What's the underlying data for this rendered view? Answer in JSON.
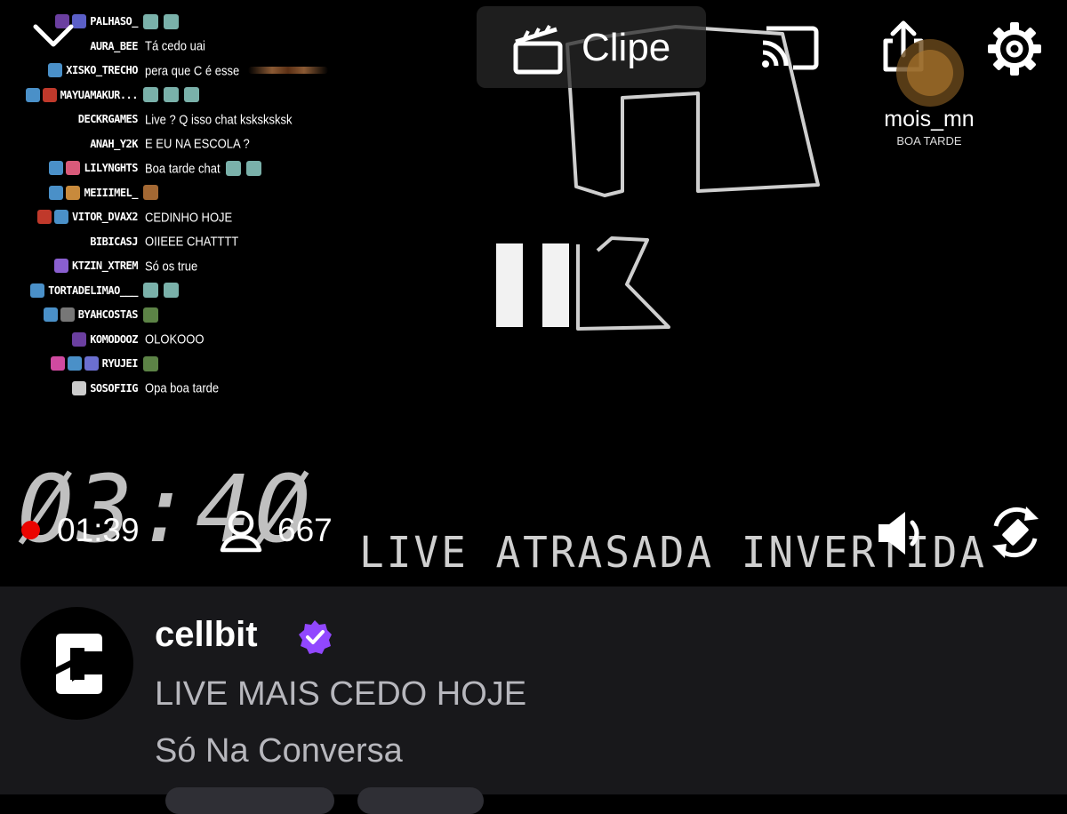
{
  "player": {
    "clip_label": "Clipe",
    "live_time": "01:39",
    "viewer_count": "667",
    "overlay_timer": "Ø3:4Ø",
    "overlay_banner": "LIVE ATRASADA INVERTIDA",
    "overlay_user": {
      "name": "mois_mn",
      "message": "BOA TARDE"
    }
  },
  "chat": [
    {
      "user": "PALHASO_",
      "text": "",
      "badges": [
        "#6b3fa0",
        "#5b5fc7"
      ],
      "emotes": 2
    },
    {
      "user": "AURA_BEE",
      "text": "Tá cedo uai",
      "badges": [],
      "emotes": 0
    },
    {
      "user": "XISKO_TRECHO",
      "text": "pera que C é esse",
      "badges": [
        "#4a90c8"
      ],
      "emotes": 0,
      "strip": true
    },
    {
      "user": "MAYUAMAKUR...",
      "text": "",
      "badges": [
        "#4a90c8",
        "#c0392b"
      ],
      "emotes": 3
    },
    {
      "user": "DECKRGAMES",
      "text": "Live ? Q isso chat ksksksksk",
      "badges": [],
      "emotes": 0
    },
    {
      "user": "ANAH_Y2K",
      "text": "E EU NA ESCOLA ?",
      "badges": [],
      "emotes": 0
    },
    {
      "user": "LILYNGHTS",
      "text": "Boa tarde chat",
      "badges": [
        "#4a90c8",
        "#d85a7a"
      ],
      "emotes": 2
    },
    {
      "user": "MEIIIMEL_",
      "text": "",
      "badges": [
        "#4a90c8",
        "#c88a3c"
      ],
      "emotes": 1,
      "emote_kind": "brown"
    },
    {
      "user": "VITOR_DVAX2",
      "text": "CEDINHO HOJE",
      "badges": [
        "#c0392b",
        "#4a90c8"
      ],
      "emotes": 0
    },
    {
      "user": "BIBICASJ",
      "text": "OIIEEE CHATTTT",
      "badges": [],
      "emotes": 0
    },
    {
      "user": "KTZIN_XTREM",
      "text": "Só os true",
      "badges": [
        "#8a5fd0"
      ],
      "emotes": 0
    },
    {
      "user": "TORTADELIMAO___",
      "text": "",
      "badges": [
        "#4a90c8"
      ],
      "emotes": 2
    },
    {
      "user": "BYAHCOSTAS",
      "text": "",
      "badges": [
        "#4a90c8",
        "#777777"
      ],
      "emotes": 1,
      "emote_kind": "green"
    },
    {
      "user": "KOMODOOZ",
      "text": "OLOKOOO",
      "badges": [
        "#6b3fa0"
      ],
      "emotes": 0
    },
    {
      "user": "RYUJEI",
      "text": "",
      "badges": [
        "#d04aa0",
        "#4a90c8",
        "#6b6fd0"
      ],
      "emotes": 1,
      "emote_kind": "green"
    },
    {
      "user": "SOSOFIIG",
      "text": "Opa boa tarde",
      "badges": [
        "#cccccc"
      ],
      "emotes": 0
    }
  ],
  "stream": {
    "channel": "cellbit",
    "title": "LIVE MAIS CEDO HOJE",
    "category": "Só Na Conversa"
  },
  "colors": {
    "live_red": "#eb0400",
    "verified_purple": "#9147ff",
    "info_bg": "#18181b",
    "muted_text": "#b7b7bd"
  }
}
